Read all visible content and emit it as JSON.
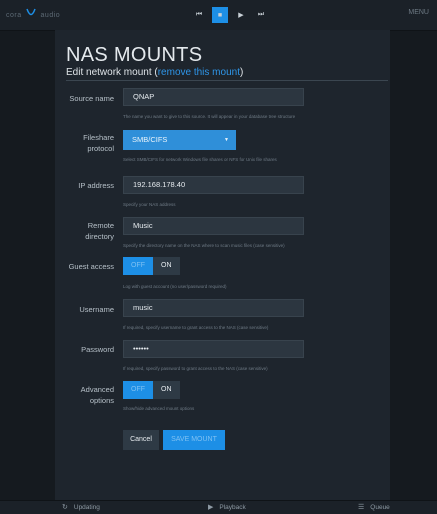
{
  "topbar": {
    "brand_left": "cora",
    "brand_right": "audio",
    "transport": {
      "prev": "⏮",
      "stop": "■",
      "play": "▶",
      "next": "⏭"
    },
    "menu_label": "MENU"
  },
  "page": {
    "title": "NAS MOUNTS",
    "subtitle_prefix": "Edit network mount (",
    "remove_link": "remove this mount",
    "subtitle_suffix": ")"
  },
  "form": {
    "source_name": {
      "label": "Source name",
      "value": "QNAP",
      "help": "The name you want to give to this source. It will appear in your database tree structure"
    },
    "fileshare_protocol": {
      "label_line1": "Fileshare",
      "label_line2": "protocol",
      "value": "SMB/CIFS",
      "help": "Select SMB/CIFS for network Windows file shares or NFS for Unix file shares"
    },
    "ip_address": {
      "label": "IP address",
      "value": "192.168.178.40",
      "help": "Specify your NAS address"
    },
    "remote_directory": {
      "label_line1": "Remote",
      "label_line2": "directory",
      "value": "Music",
      "help": "Specify the directory name on the NAS where to scan music files (case sensitive)"
    },
    "guest_access": {
      "label": "Guest access",
      "off_label": "OFF",
      "on_label": "ON",
      "help": "Log with guest account (no user/password required)"
    },
    "username": {
      "label": "Username",
      "value": "music",
      "help": "If required, specify username to grant access to the NAS (case sensitive)"
    },
    "password": {
      "label": "Password",
      "value": "••••••",
      "help": "If required, specify password to grant access to the NAS (case sensitive)"
    },
    "advanced_options": {
      "label_line1": "Advanced",
      "label_line2": "options",
      "off_label": "OFF",
      "on_label": "ON",
      "help": "Show/hide advanced mount options"
    },
    "buttons": {
      "cancel": "Cancel",
      "save": "SAVE MOUNT"
    }
  },
  "bottombar": {
    "left": "Updating",
    "center": "Playback",
    "right": "Queue"
  },
  "colors": {
    "accent": "#1d8fe6",
    "background": "#151a1f",
    "panel": "#1e252d",
    "field": "#2c3640"
  },
  "icons": {
    "brand": "brand-logo-icon",
    "updating": "refresh-icon",
    "playback": "play-icon",
    "queue": "list-icon"
  }
}
